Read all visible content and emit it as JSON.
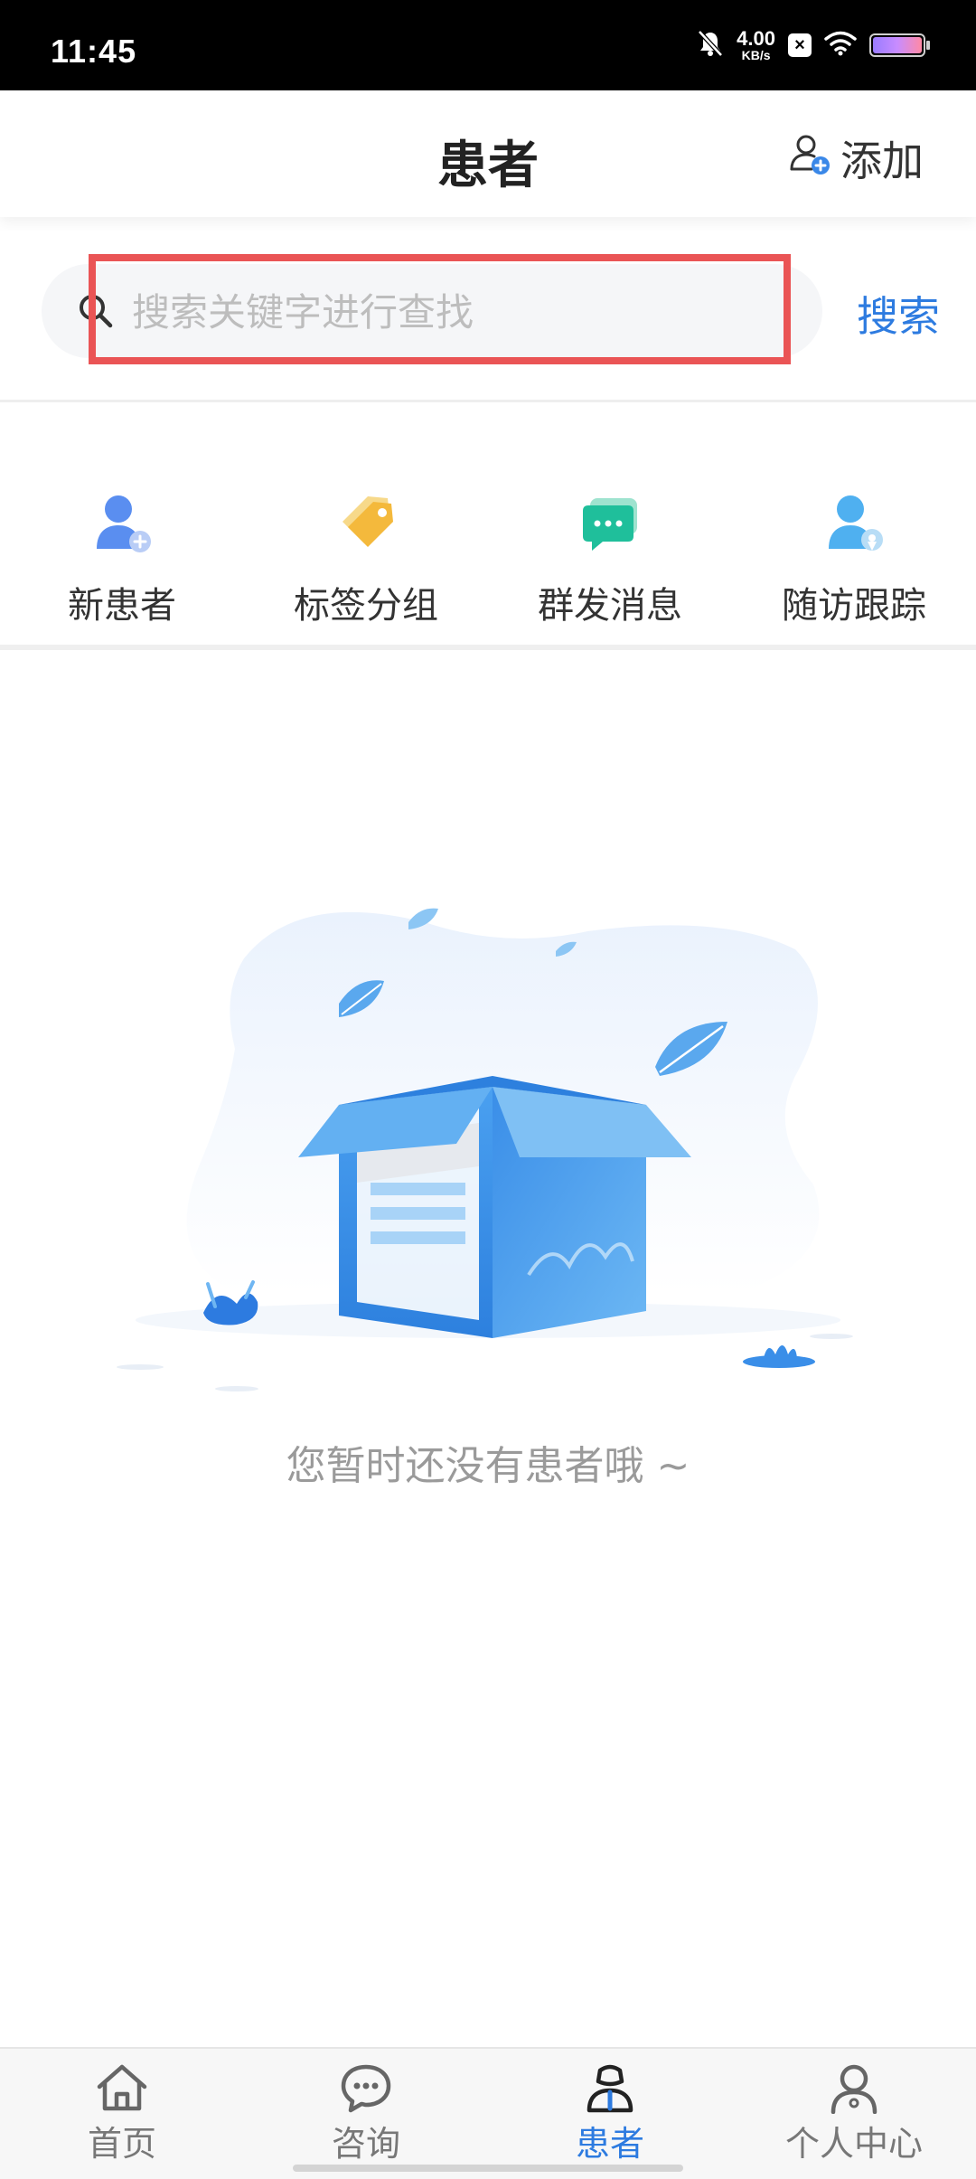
{
  "status_bar": {
    "time": "11:45",
    "net_speed_value": "4.00",
    "net_speed_unit": "KB/s"
  },
  "header": {
    "title": "患者",
    "add_label": "添加"
  },
  "search": {
    "placeholder": "搜索关键字进行查找",
    "button_label": "搜索"
  },
  "quick_actions": [
    {
      "label": "新患者",
      "icon": "new-patient-icon"
    },
    {
      "label": "标签分组",
      "icon": "tag-icon"
    },
    {
      "label": "群发消息",
      "icon": "message-icon"
    },
    {
      "label": "随访跟踪",
      "icon": "follow-up-icon"
    }
  ],
  "empty_state": {
    "message": "您暂时还没有患者哦 ~"
  },
  "bottom_nav": {
    "active": "患者",
    "tabs": [
      {
        "label": "首页",
        "icon": "home-icon"
      },
      {
        "label": "咨询",
        "icon": "chat-icon"
      },
      {
        "label": "患者",
        "icon": "patient-icon"
      },
      {
        "label": "个人中心",
        "icon": "profile-icon"
      }
    ]
  },
  "colors": {
    "accent": "#2d7be0",
    "highlight_box": "#ea5455"
  }
}
